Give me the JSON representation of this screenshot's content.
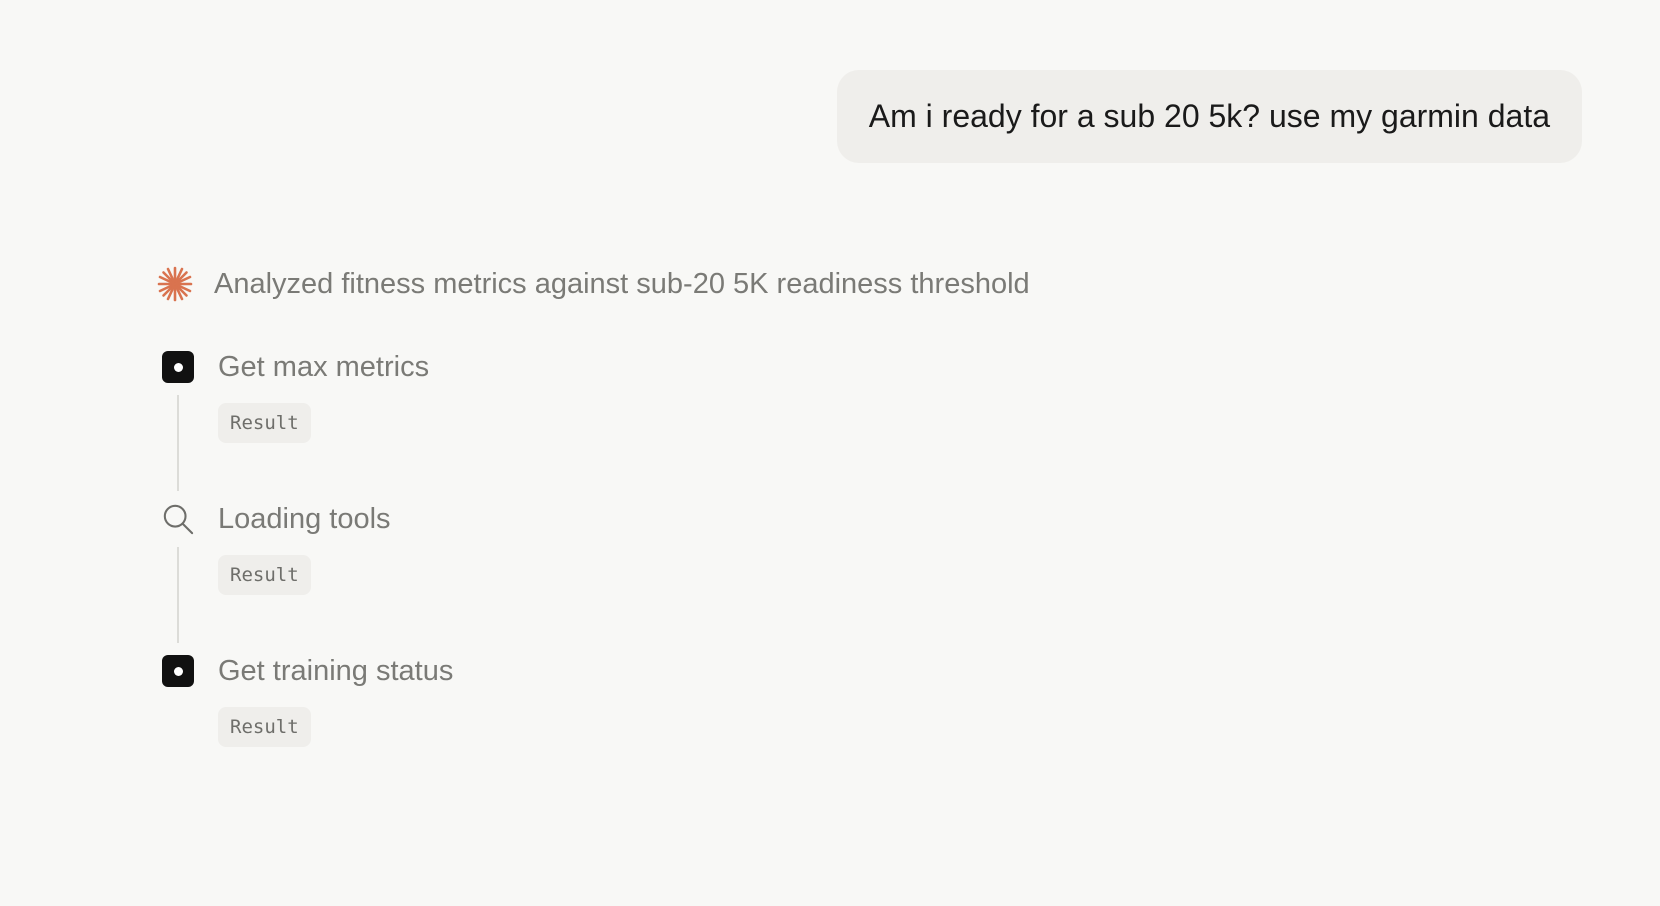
{
  "user_message": "Am i ready for a sub 20 5k? use my garmin data",
  "summary": {
    "icon": "spark-icon",
    "icon_color": "#d9734f",
    "text": "Analyzed fitness metrics against sub-20 5K readiness threshold"
  },
  "steps": [
    {
      "icon": "tool-box-icon",
      "title": "Get max metrics",
      "result_label": "Result"
    },
    {
      "icon": "search-icon",
      "title": "Loading tools",
      "result_label": "Result"
    },
    {
      "icon": "tool-box-icon",
      "title": "Get training status",
      "result_label": "Result"
    }
  ]
}
